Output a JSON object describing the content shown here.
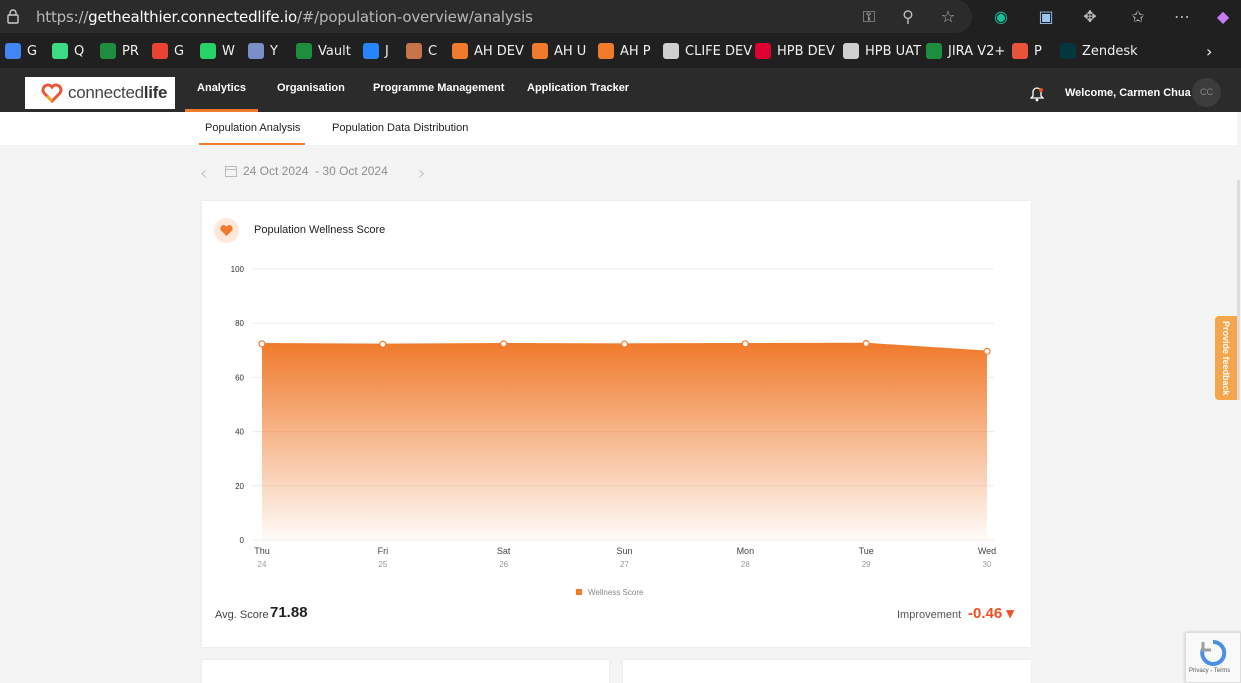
{
  "browser": {
    "url_prefix": "https://",
    "url_domain": "gethealthier.connectedlife.io",
    "url_path": "/#/population-overview/analysis",
    "bookmarks": [
      {
        "label": "G",
        "icon": "google-icon",
        "color": "#4285f4"
      },
      {
        "label": "Q",
        "icon": "android-icon",
        "color": "#3ddc84"
      },
      {
        "label": "PR",
        "icon": "sheets-icon",
        "color": "#1e8e3e"
      },
      {
        "label": "G",
        "icon": "gmail-icon",
        "color": "#ea4335"
      },
      {
        "label": "W",
        "icon": "whatsapp-icon",
        "color": "#25d366"
      },
      {
        "label": "Y",
        "icon": "yammer-icon",
        "color": "#7a8fc7"
      },
      {
        "label": "Vault",
        "icon": "sheets-icon",
        "color": "#1e8e3e"
      },
      {
        "label": "J",
        "icon": "jira-icon",
        "color": "#2684ff"
      },
      {
        "label": "C",
        "icon": "photo-icon",
        "color": "#c8734b"
      },
      {
        "label": "AH DEV",
        "icon": "heart-link-icon",
        "color": "#f07b2c"
      },
      {
        "label": "AH U",
        "icon": "heart-link-icon",
        "color": "#f07b2c"
      },
      {
        "label": "AH P",
        "icon": "heart-link-icon",
        "color": "#f07b2c"
      },
      {
        "label": "CLIFE DEV",
        "icon": "document-icon",
        "color": "#cfcfcf"
      },
      {
        "label": "HPB DEV",
        "icon": "angular-icon",
        "color": "#dd0031"
      },
      {
        "label": "HPB UAT",
        "icon": "document-icon",
        "color": "#cfcfcf"
      },
      {
        "label": "JIRA V2+",
        "icon": "sheets-icon",
        "color": "#1e8e3e"
      },
      {
        "label": "P",
        "icon": "pocketbase-icon",
        "color": "#e8533a"
      },
      {
        "label": "Zendesk",
        "icon": "zendesk-icon",
        "color": "#03363d"
      }
    ]
  },
  "app": {
    "logo": {
      "text_light": "connected",
      "text_bold": "life"
    },
    "nav": [
      "Analytics",
      "Organisation",
      "Programme Management",
      "Application Tracker"
    ],
    "welcome": "Welcome, Carmen Chua",
    "avatar_initials": "CC",
    "subtabs": [
      "Population Analysis",
      "Population Data Distribution"
    ],
    "date_start": "24 Oct 2024",
    "date_end": "- 30 Oct 2024",
    "feedback_label": "Provide feedback",
    "recaptcha_label": "Privacy - Terms"
  },
  "card": {
    "title": "Population Wellness Score",
    "avg_label": "Avg. Score",
    "avg_value": "71.88",
    "improvement_label": "Improvement",
    "improvement_value": "-0.46 ▾",
    "accent_color": "#f07b2c",
    "negative_color": "#f04f23"
  },
  "chart_data": {
    "type": "area",
    "title": "",
    "x": [
      "Thu",
      "Fri",
      "Sat",
      "Sun",
      "Mon",
      "Tue",
      "Wed"
    ],
    "x_sub": [
      "24",
      "25",
      "26",
      "27",
      "28",
      "29",
      "30"
    ],
    "series": [
      {
        "name": "Wellness Score",
        "values": [
          72.4,
          72.2,
          72.4,
          72.3,
          72.4,
          72.5,
          69.6
        ]
      }
    ],
    "ylim": [
      0,
      100
    ],
    "yticks": [
      0,
      20,
      40,
      60,
      80,
      100
    ],
    "grid": true,
    "legend": "bottom-center",
    "color": "#f07b2c"
  }
}
